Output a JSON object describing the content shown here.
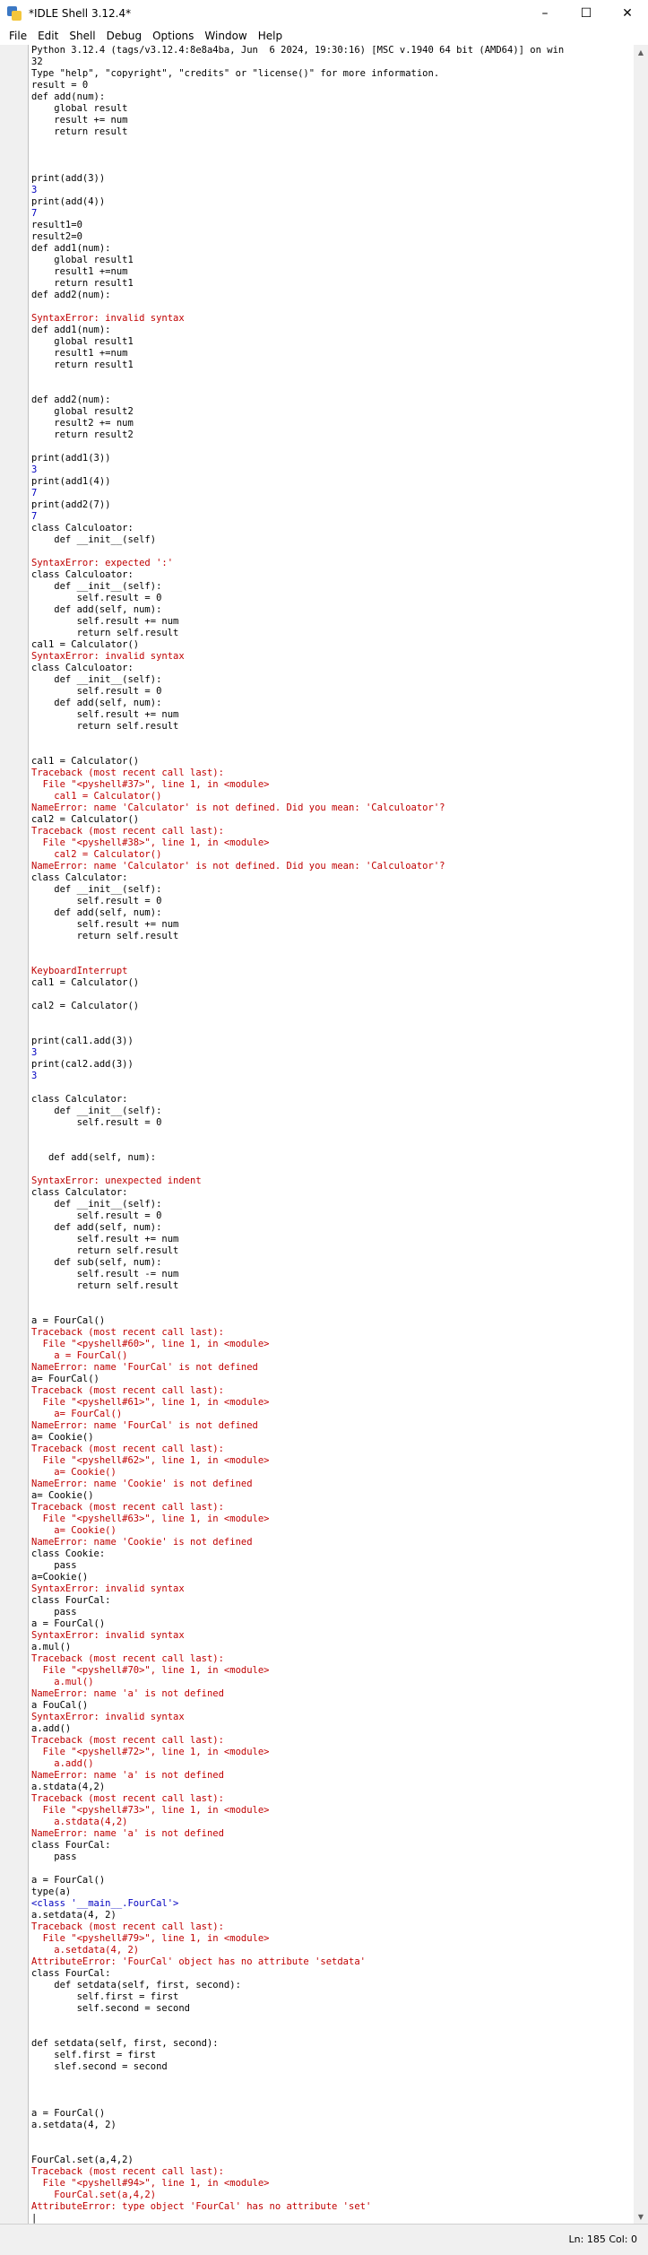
{
  "window": {
    "title": "*IDLE Shell 3.12.4*"
  },
  "menu": [
    "File",
    "Edit",
    "Shell",
    "Debug",
    "Options",
    "Window",
    "Help"
  ],
  "lines": [
    {
      "p": "",
      "t": "Python 3.12.4 (tags/v3.12.4:8e8a4ba, Jun  6 2024, 19:30:16) [MSC v.1940 64 bit (AMD64)] on win",
      "k": "info"
    },
    {
      "p": "",
      "t": "32",
      "k": "info"
    },
    {
      "p": "",
      "t": "Type \"help\", \"copyright\", \"credits\" or \"license()\" for more information.",
      "k": "info"
    },
    {
      "p": ">>>",
      "t": "result = 0",
      "k": "code"
    },
    {
      "p": ">>>",
      "t": "def add(num):",
      "k": "code"
    },
    {
      "p": "...",
      "t": "    global result",
      "k": "code"
    },
    {
      "p": "...",
      "t": "    result += num",
      "k": "code"
    },
    {
      "p": "...",
      "t": "    return result",
      "k": "code"
    },
    {
      "p": "...",
      "t": "",
      "k": "code"
    },
    {
      "p": ">>>",
      "t": "",
      "k": "code"
    },
    {
      "p": ">>>",
      "t": "",
      "k": "code"
    },
    {
      "p": ">>>",
      "t": "print(add(3))",
      "k": "code"
    },
    {
      "p": "",
      "t": "3",
      "k": "out"
    },
    {
      "p": ">>>",
      "t": "print(add(4))",
      "k": "code"
    },
    {
      "p": "",
      "t": "7",
      "k": "out"
    },
    {
      "p": ">>>",
      "t": "result1=0",
      "k": "code"
    },
    {
      "p": ">>>",
      "t": "result2=0",
      "k": "code"
    },
    {
      "p": ">>>",
      "t": "def add1(num):",
      "k": "code"
    },
    {
      "p": "...",
      "t": "    global result1",
      "k": "code"
    },
    {
      "p": "...",
      "t": "    result1 +=num",
      "k": "code"
    },
    {
      "p": "...",
      "t": "    return result1",
      "k": "code"
    },
    {
      "p": "...",
      "t": "def add2(num):",
      "k": "code"
    },
    {
      "p": "...",
      "t": "",
      "k": "code"
    },
    {
      "p": "",
      "t": "SyntaxError: invalid syntax",
      "k": "err"
    },
    {
      "p": ">>>",
      "t": "def add1(num):",
      "k": "code"
    },
    {
      "p": "...",
      "t": "    global result1",
      "k": "code"
    },
    {
      "p": "...",
      "t": "    result1 +=num",
      "k": "code"
    },
    {
      "p": "...",
      "t": "    return result1",
      "k": "code"
    },
    {
      "p": "...",
      "t": "",
      "k": "code"
    },
    {
      "p": ">>>",
      "t": "",
      "k": "code"
    },
    {
      "p": ">>>",
      "t": "def add2(num):",
      "k": "code"
    },
    {
      "p": "...",
      "t": "    global result2",
      "k": "code"
    },
    {
      "p": "...",
      "t": "    result2 += num",
      "k": "code"
    },
    {
      "p": "...",
      "t": "    return result2",
      "k": "code"
    },
    {
      "p": "...",
      "t": "",
      "k": "code"
    },
    {
      "p": ">>>",
      "t": "print(add1(3))",
      "k": "code"
    },
    {
      "p": "",
      "t": "3",
      "k": "out"
    },
    {
      "p": ">>>",
      "t": "print(add1(4))",
      "k": "code"
    },
    {
      "p": "",
      "t": "7",
      "k": "out"
    },
    {
      "p": ">>>",
      "t": "print(add2(7))",
      "k": "code"
    },
    {
      "p": "",
      "t": "7",
      "k": "out"
    },
    {
      "p": ">>>",
      "t": "class Calculoator:",
      "k": "code"
    },
    {
      "p": "...",
      "t": "    def __init__(self)",
      "k": "code"
    },
    {
      "p": "...",
      "t": "",
      "k": "code"
    },
    {
      "p": "",
      "t": "SyntaxError: expected ':'",
      "k": "err"
    },
    {
      "p": ">>>",
      "t": "class Calculoator:",
      "k": "code"
    },
    {
      "p": "...",
      "t": "    def __init__(self):",
      "k": "code"
    },
    {
      "p": "...",
      "t": "        self.result = 0",
      "k": "code"
    },
    {
      "p": "...",
      "t": "    def add(self, num):",
      "k": "code"
    },
    {
      "p": "...",
      "t": "        self.result += num",
      "k": "code"
    },
    {
      "p": "...",
      "t": "        return self.result",
      "k": "code"
    },
    {
      "p": "...",
      "t": "cal1 = Calculator()",
      "k": "code"
    },
    {
      "p": "",
      "t": "SyntaxError: invalid syntax",
      "k": "err"
    },
    {
      "p": ">>>",
      "t": "class Calculoator:",
      "k": "code"
    },
    {
      "p": "...",
      "t": "    def __init__(self):",
      "k": "code"
    },
    {
      "p": "...",
      "t": "        self.result = 0",
      "k": "code"
    },
    {
      "p": "...",
      "t": "    def add(self, num):",
      "k": "code"
    },
    {
      "p": "...",
      "t": "        self.result += num",
      "k": "code"
    },
    {
      "p": "...",
      "t": "        return self.result",
      "k": "code"
    },
    {
      "p": "...",
      "t": "",
      "k": "code"
    },
    {
      "p": ">>>",
      "t": "",
      "k": "code"
    },
    {
      "p": ">>>",
      "t": "cal1 = Calculator()",
      "k": "code"
    },
    {
      "p": "",
      "t": "Traceback (most recent call last):",
      "k": "err"
    },
    {
      "p": "",
      "t": "  File \"<pyshell#37>\", line 1, in <module>",
      "k": "err"
    },
    {
      "p": "",
      "t": "    cal1 = Calculator()",
      "k": "err"
    },
    {
      "p": "",
      "t": "NameError: name 'Calculator' is not defined. Did you mean: 'Calculoator'?",
      "k": "err"
    },
    {
      "p": ">>>",
      "t": "cal2 = Calculator()",
      "k": "code"
    },
    {
      "p": "",
      "t": "Traceback (most recent call last):",
      "k": "err"
    },
    {
      "p": "",
      "t": "  File \"<pyshell#38>\", line 1, in <module>",
      "k": "err"
    },
    {
      "p": "",
      "t": "    cal2 = Calculator()",
      "k": "err"
    },
    {
      "p": "",
      "t": "NameError: name 'Calculator' is not defined. Did you mean: 'Calculoator'?",
      "k": "err"
    },
    {
      "p": ">>>",
      "t": "class Calculator:",
      "k": "code"
    },
    {
      "p": "...",
      "t": "    def __init__(self):",
      "k": "code"
    },
    {
      "p": "...",
      "t": "        self.result = 0",
      "k": "code"
    },
    {
      "p": "...",
      "t": "    def add(self, num):",
      "k": "code"
    },
    {
      "p": "...",
      "t": "        self.result += num",
      "k": "code"
    },
    {
      "p": "...",
      "t": "        return self.result",
      "k": "code"
    },
    {
      "p": "...",
      "t": "",
      "k": "code"
    },
    {
      "p": "...",
      "t": "",
      "k": "code"
    },
    {
      "p": "",
      "t": "KeyboardInterrupt",
      "k": "err"
    },
    {
      "p": ">>>",
      "t": "cal1 = Calculator()",
      "k": "code"
    },
    {
      "p": ">>>",
      "t": "",
      "k": "code"
    },
    {
      "p": ">>>",
      "t": "cal2 = Calculator()",
      "k": "code"
    },
    {
      "p": ">>>",
      "t": "",
      "k": "code"
    },
    {
      "p": ">>>",
      "t": "",
      "k": "code"
    },
    {
      "p": ">>>",
      "t": "print(cal1.add(3))",
      "k": "code"
    },
    {
      "p": "",
      "t": "3",
      "k": "out"
    },
    {
      "p": ">>>",
      "t": "print(cal2.add(3))",
      "k": "code"
    },
    {
      "p": "",
      "t": "3",
      "k": "out"
    },
    {
      "p": ">>>",
      "t": "",
      "k": "code"
    },
    {
      "p": ">>>",
      "t": "class Calculator:",
      "k": "code"
    },
    {
      "p": "...",
      "t": "    def __init__(self):",
      "k": "code"
    },
    {
      "p": "...",
      "t": "        self.result = 0",
      "k": "code"
    },
    {
      "p": "...",
      "t": "",
      "k": "code"
    },
    {
      "p": "...",
      "t": "",
      "k": "code"
    },
    {
      "p": "...",
      "t": "   def add(self, num):",
      "k": "code"
    },
    {
      "p": "...",
      "t": "",
      "k": "code"
    },
    {
      "p": "",
      "t": "SyntaxError: unexpected indent",
      "k": "err"
    },
    {
      "p": ">>>",
      "t": "class Calculator:",
      "k": "code"
    },
    {
      "p": "...",
      "t": "    def __init__(self):",
      "k": "code"
    },
    {
      "p": "...",
      "t": "        self.result = 0",
      "k": "code"
    },
    {
      "p": "...",
      "t": "    def add(self, num):",
      "k": "code"
    },
    {
      "p": "...",
      "t": "        self.result += num",
      "k": "code"
    },
    {
      "p": "...",
      "t": "        return self.result",
      "k": "code"
    },
    {
      "p": "...",
      "t": "    def sub(self, num):",
      "k": "code"
    },
    {
      "p": "...",
      "t": "        self.result -= num",
      "k": "code"
    },
    {
      "p": "...",
      "t": "        return self.result",
      "k": "code"
    },
    {
      "p": "...",
      "t": "",
      "k": "code"
    },
    {
      "p": "...",
      "t": "",
      "k": "code"
    },
    {
      "p": ">>>",
      "t": "a = FourCal()",
      "k": "code"
    },
    {
      "p": "",
      "t": "Traceback (most recent call last):",
      "k": "err"
    },
    {
      "p": "",
      "t": "  File \"<pyshell#60>\", line 1, in <module>",
      "k": "err"
    },
    {
      "p": "",
      "t": "    a = FourCal()",
      "k": "err"
    },
    {
      "p": "",
      "t": "NameError: name 'FourCal' is not defined",
      "k": "err"
    },
    {
      "p": ">>>",
      "t": "a= FourCal()",
      "k": "code"
    },
    {
      "p": "",
      "t": "Traceback (most recent call last):",
      "k": "err"
    },
    {
      "p": "",
      "t": "  File \"<pyshell#61>\", line 1, in <module>",
      "k": "err"
    },
    {
      "p": "",
      "t": "    a= FourCal()",
      "k": "err"
    },
    {
      "p": "",
      "t": "NameError: name 'FourCal' is not defined",
      "k": "err"
    },
    {
      "p": ">>>",
      "t": "a= Cookie()",
      "k": "code"
    },
    {
      "p": "",
      "t": "Traceback (most recent call last):",
      "k": "err"
    },
    {
      "p": "",
      "t": "  File \"<pyshell#62>\", line 1, in <module>",
      "k": "err"
    },
    {
      "p": "",
      "t": "    a= Cookie()",
      "k": "err"
    },
    {
      "p": "",
      "t": "NameError: name 'Cookie' is not defined",
      "k": "err"
    },
    {
      "p": ">>>",
      "t": "a= Cookie()",
      "k": "code"
    },
    {
      "p": "",
      "t": "Traceback (most recent call last):",
      "k": "err"
    },
    {
      "p": "",
      "t": "  File \"<pyshell#63>\", line 1, in <module>",
      "k": "err"
    },
    {
      "p": "",
      "t": "    a= Cookie()",
      "k": "err"
    },
    {
      "p": "",
      "t": "NameError: name 'Cookie' is not defined",
      "k": "err"
    },
    {
      "p": ">>>",
      "t": "class Cookie:",
      "k": "code"
    },
    {
      "p": "...",
      "t": "    pass",
      "k": "code"
    },
    {
      "p": "...",
      "t": "a=Cookie()",
      "k": "code"
    },
    {
      "p": "",
      "t": "SyntaxError: invalid syntax",
      "k": "err"
    },
    {
      "p": ">>>",
      "t": "class FourCal:",
      "k": "code"
    },
    {
      "p": "...",
      "t": "    pass",
      "k": "code"
    },
    {
      "p": "...",
      "t": "a = FourCal()",
      "k": "code"
    },
    {
      "p": "",
      "t": "SyntaxError: invalid syntax",
      "k": "err"
    },
    {
      "p": ">>>",
      "t": "a.mul()",
      "k": "code"
    },
    {
      "p": "",
      "t": "Traceback (most recent call last):",
      "k": "err"
    },
    {
      "p": "",
      "t": "  File \"<pyshell#70>\", line 1, in <module>",
      "k": "err"
    },
    {
      "p": "",
      "t": "    a.mul()",
      "k": "err"
    },
    {
      "p": "",
      "t": "NameError: name 'a' is not defined",
      "k": "err"
    },
    {
      "p": ">>>",
      "t": "a FouCal()",
      "k": "code"
    },
    {
      "p": "",
      "t": "SyntaxError: invalid syntax",
      "k": "err"
    },
    {
      "p": ">>>",
      "t": "a.add()",
      "k": "code"
    },
    {
      "p": "",
      "t": "Traceback (most recent call last):",
      "k": "err"
    },
    {
      "p": "",
      "t": "  File \"<pyshell#72>\", line 1, in <module>",
      "k": "err"
    },
    {
      "p": "",
      "t": "    a.add()",
      "k": "err"
    },
    {
      "p": "",
      "t": "NameError: name 'a' is not defined",
      "k": "err"
    },
    {
      "p": ">>>",
      "t": "a.stdata(4,2)",
      "k": "code"
    },
    {
      "p": "",
      "t": "Traceback (most recent call last):",
      "k": "err"
    },
    {
      "p": "",
      "t": "  File \"<pyshell#73>\", line 1, in <module>",
      "k": "err"
    },
    {
      "p": "",
      "t": "    a.stdata(4,2)",
      "k": "err"
    },
    {
      "p": "",
      "t": "NameError: name 'a' is not defined",
      "k": "err"
    },
    {
      "p": ">>>",
      "t": "class FourCal:",
      "k": "code"
    },
    {
      "p": "...",
      "t": "    pass",
      "k": "code"
    },
    {
      "p": "...",
      "t": "",
      "k": "code"
    },
    {
      "p": ">>>",
      "t": "a = FourCal()",
      "k": "code"
    },
    {
      "p": ">>>",
      "t": "type(a)",
      "k": "code"
    },
    {
      "p": "",
      "t": "<class '__main__.FourCal'>",
      "k": "out"
    },
    {
      "p": ">>>",
      "t": "a.setdata(4, 2)",
      "k": "code"
    },
    {
      "p": "",
      "t": "Traceback (most recent call last):",
      "k": "err"
    },
    {
      "p": "",
      "t": "  File \"<pyshell#79>\", line 1, in <module>",
      "k": "err"
    },
    {
      "p": "",
      "t": "    a.setdata(4, 2)",
      "k": "err"
    },
    {
      "p": "",
      "t": "AttributeError: 'FourCal' object has no attribute 'setdata'",
      "k": "err"
    },
    {
      "p": ">>>",
      "t": "class FourCal:",
      "k": "code"
    },
    {
      "p": "...",
      "t": "    def setdata(self, first, second):",
      "k": "code"
    },
    {
      "p": "...",
      "t": "        self.first = first",
      "k": "code"
    },
    {
      "p": "...",
      "t": "        self.second = second",
      "k": "code"
    },
    {
      "p": "...",
      "t": "",
      "k": "code"
    },
    {
      "p": "...",
      "t": "",
      "k": "code"
    },
    {
      "p": ">>>",
      "t": "def setdata(self, first, second):",
      "k": "code"
    },
    {
      "p": "...",
      "t": "    self.first = first",
      "k": "code"
    },
    {
      "p": "...",
      "t": "    slef.second = second",
      "k": "code"
    },
    {
      "p": "...",
      "t": "",
      "k": "code"
    },
    {
      "p": "...",
      "t": "",
      "k": "code"
    },
    {
      "p": "...",
      "t": "",
      "k": "code"
    },
    {
      "p": ">>>",
      "t": "a = FourCal()",
      "k": "code"
    },
    {
      "p": ">>>",
      "t": "a.setdata(4, 2)",
      "k": "code"
    },
    {
      "p": ">>>",
      "t": "",
      "k": "code"
    },
    {
      "p": ">>>",
      "t": "",
      "k": "code"
    },
    {
      "p": ">>>",
      "t": "FourCal.set(a,4,2)",
      "k": "code"
    },
    {
      "p": "",
      "t": "Traceback (most recent call last):",
      "k": "err"
    },
    {
      "p": "",
      "t": "  File \"<pyshell#94>\", line 1, in <module>",
      "k": "err"
    },
    {
      "p": "",
      "t": "    FourCal.set(a,4,2)",
      "k": "err"
    },
    {
      "p": "",
      "t": "AttributeError: type object 'FourCal' has no attribute 'set'",
      "k": "err"
    },
    {
      "p": ">>>",
      "t": "|",
      "k": "code"
    }
  ],
  "status": {
    "position": "Ln: 185   Col: 0"
  }
}
